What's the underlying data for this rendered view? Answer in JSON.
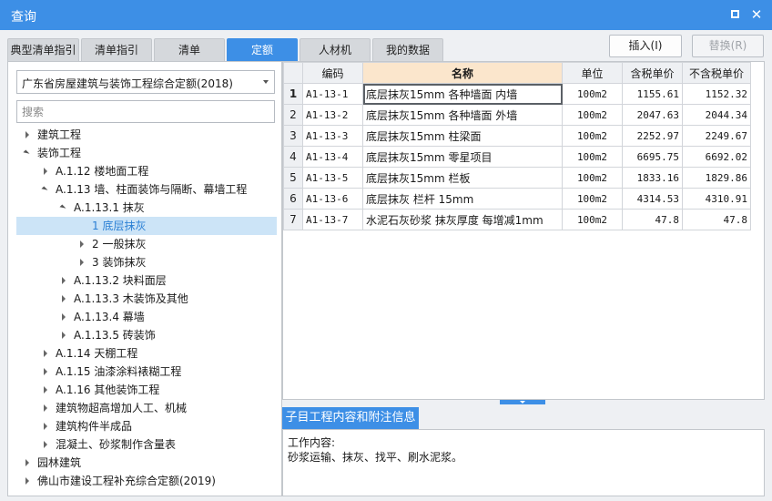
{
  "window": {
    "title": "查询"
  },
  "tabs": [
    {
      "label": "典型清单指引",
      "active": false
    },
    {
      "label": "清单指引",
      "active": false
    },
    {
      "label": "清单",
      "active": false
    },
    {
      "label": "定额",
      "active": true
    },
    {
      "label": "人材机",
      "active": false
    },
    {
      "label": "我的数据",
      "active": false
    }
  ],
  "toolbar": {
    "insert_label": "插入(I)",
    "replace_label": "替换(R)"
  },
  "library": {
    "selected": "广东省房屋建筑与装饰工程综合定额(2018)"
  },
  "search": {
    "placeholder": "搜索",
    "value": ""
  },
  "tree": [
    {
      "label": "建筑工程",
      "level": 0,
      "state": "collapsed"
    },
    {
      "label": "装饰工程",
      "level": 0,
      "state": "expanded"
    },
    {
      "label": "A.1.12 楼地面工程",
      "level": 1,
      "state": "collapsed"
    },
    {
      "label": "A.1.13 墙、柱面装饰与隔断、幕墙工程",
      "level": 1,
      "state": "expanded"
    },
    {
      "label": "A.1.13.1 抹灰",
      "level": 2,
      "state": "expanded"
    },
    {
      "label": "1 底层抹灰",
      "level": 3,
      "state": "leaf",
      "selected": true
    },
    {
      "label": "2 一般抹灰",
      "level": 3,
      "state": "collapsed"
    },
    {
      "label": "3 装饰抹灰",
      "level": 3,
      "state": "collapsed"
    },
    {
      "label": "A.1.13.2 块料面层",
      "level": 2,
      "state": "collapsed"
    },
    {
      "label": "A.1.13.3 木装饰及其他",
      "level": 2,
      "state": "collapsed"
    },
    {
      "label": "A.1.13.4 幕墙",
      "level": 2,
      "state": "collapsed"
    },
    {
      "label": "A.1.13.5 砖装饰",
      "level": 2,
      "state": "collapsed"
    },
    {
      "label": "A.1.14 天棚工程",
      "level": 1,
      "state": "collapsed"
    },
    {
      "label": "A.1.15 油漆涂料裱糊工程",
      "level": 1,
      "state": "collapsed"
    },
    {
      "label": "A.1.16 其他装饰工程",
      "level": 1,
      "state": "collapsed"
    },
    {
      "label": "建筑物超高增加人工、机械",
      "level": 1,
      "state": "collapsed"
    },
    {
      "label": "建筑构件半成品",
      "level": 1,
      "state": "collapsed"
    },
    {
      "label": "混凝土、砂浆制作含量表",
      "level": 1,
      "state": "collapsed"
    },
    {
      "label": "园林建筑",
      "level": 0,
      "state": "collapsed"
    },
    {
      "label": "佛山市建设工程补充综合定额(2019)",
      "level": 0,
      "state": "collapsed"
    }
  ],
  "grid": {
    "headers": [
      "编码",
      "名称",
      "单位",
      "含税单价",
      "不含税单价"
    ],
    "rows": [
      {
        "index": "1",
        "code": "A1-13-1",
        "name": "底层抹灰15mm 各种墙面 内墙",
        "unit": "100m2",
        "price_tax": "1155.61",
        "price_notax": "1152.32",
        "current": true
      },
      {
        "index": "2",
        "code": "A1-13-2",
        "name": "底层抹灰15mm 各种墙面 外墙",
        "unit": "100m2",
        "price_tax": "2047.63",
        "price_notax": "2044.34"
      },
      {
        "index": "3",
        "code": "A1-13-3",
        "name": "底层抹灰15mm 柱梁面",
        "unit": "100m2",
        "price_tax": "2252.97",
        "price_notax": "2249.67"
      },
      {
        "index": "4",
        "code": "A1-13-4",
        "name": "底层抹灰15mm 零星项目",
        "unit": "100m2",
        "price_tax": "6695.75",
        "price_notax": "6692.02"
      },
      {
        "index": "5",
        "code": "A1-13-5",
        "name": "底层抹灰15mm 栏板",
        "unit": "100m2",
        "price_tax": "1833.16",
        "price_notax": "1829.86"
      },
      {
        "index": "6",
        "code": "A1-13-6",
        "name": "底层抹灰 栏杆 15mm",
        "unit": "100m2",
        "price_tax": "4314.53",
        "price_notax": "4310.91"
      },
      {
        "index": "7",
        "code": "A1-13-7",
        "name": "水泥石灰砂浆 抹灰厚度 每增减1mm",
        "unit": "100m2",
        "price_tax": "47.8",
        "price_notax": "47.8"
      }
    ]
  },
  "detail": {
    "tab_label": "子目工程内容和附注信息",
    "heading": "工作内容:",
    "content": "砂浆运输、抹灰、找平、刷水泥浆。"
  },
  "colors": {
    "accent": "#3d8fe6",
    "selected_bg": "#cce4f7",
    "name_header_bg": "#fbe6cc"
  }
}
